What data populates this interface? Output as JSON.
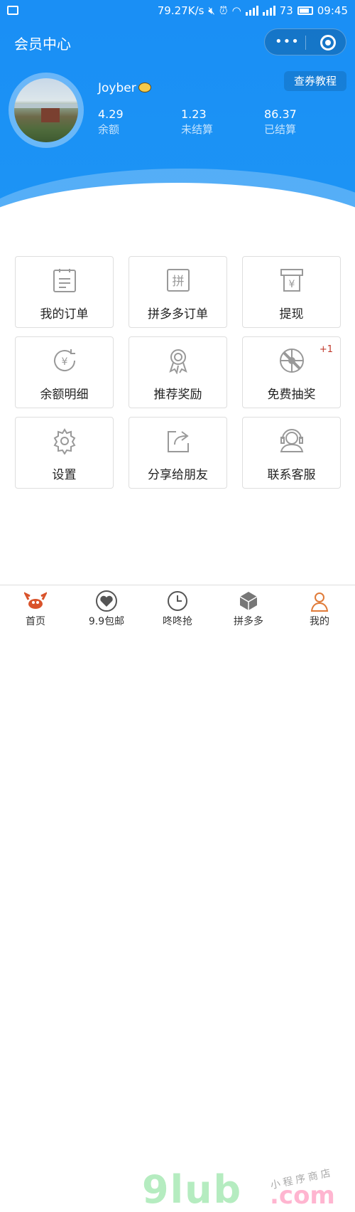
{
  "status_bar": {
    "speed": "79.27K/s",
    "battery_level": "73",
    "time": "09:45"
  },
  "header": {
    "title": "会员中心",
    "menu_glyph": "•••",
    "tutorial_button": "查券教程",
    "username": "Joyber",
    "stats": [
      {
        "value": "4.29",
        "label": "余额"
      },
      {
        "value": "1.23",
        "label": "未结算"
      },
      {
        "value": "86.37",
        "label": "已结算"
      }
    ]
  },
  "menu": [
    {
      "label": "我的订单",
      "icon": "clipboard-icon"
    },
    {
      "label": "拼多多订单",
      "icon": "pin-icon",
      "glyph": "拼"
    },
    {
      "label": "提现",
      "icon": "atm-yen-icon",
      "glyph": "¥"
    },
    {
      "label": "余额明细",
      "icon": "yen-cycle-icon",
      "glyph": "¥"
    },
    {
      "label": "推荐奖励",
      "icon": "medal-icon"
    },
    {
      "label": "免费抽奖",
      "icon": "lottery-wheel-icon",
      "badge": "+1"
    },
    {
      "label": "设置",
      "icon": "gear-icon"
    },
    {
      "label": "分享给朋友",
      "icon": "share-icon"
    },
    {
      "label": "联系客服",
      "icon": "headset-icon"
    }
  ],
  "tabbar": [
    {
      "label": "首页",
      "icon": "crab-icon"
    },
    {
      "label": "9.9包邮",
      "icon": "heart-icon"
    },
    {
      "label": "咚咚抢",
      "icon": "clock-icon"
    },
    {
      "label": "拼多多",
      "icon": "cube-icon"
    },
    {
      "label": "我的",
      "icon": "user-icon"
    }
  ],
  "watermark": {
    "main": "9lub",
    "suffix": ".com",
    "caption": "小程序商店"
  },
  "colors": {
    "brand_blue": "#1a8ff5",
    "badge_red": "#c0392b"
  }
}
